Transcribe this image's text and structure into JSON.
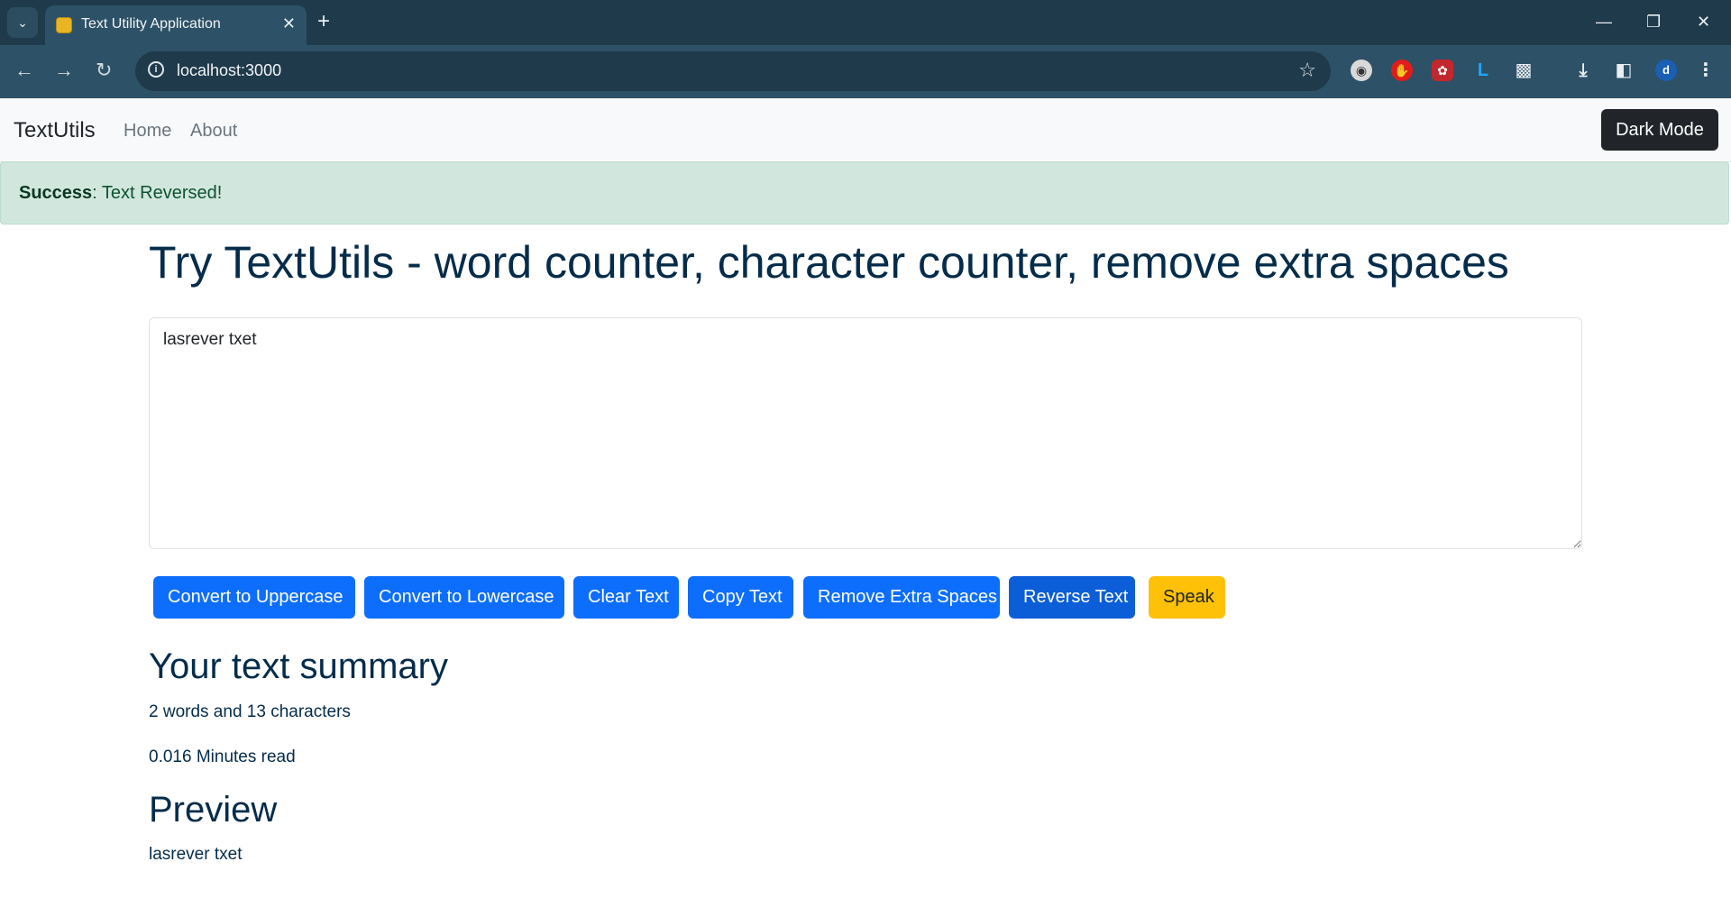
{
  "browser": {
    "tab_title": "Text Utility Application",
    "url": "localhost:3000"
  },
  "navbar": {
    "brand": "TextUtils",
    "links": [
      "Home",
      "About"
    ],
    "dark_mode_label": "Dark Mode"
  },
  "alert": {
    "type_label": "Success",
    "message": ": Text Reversed!"
  },
  "main": {
    "title": "Try TextUtils - word counter, character counter, remove extra spaces",
    "textarea_value": "lasrever txet",
    "buttons": [
      "Convert to Uppercase",
      "Convert to Lowercase",
      "Clear Text",
      "Copy Text",
      "Remove Extra Spaces",
      "Reverse Text",
      "Speak"
    ]
  },
  "summary": {
    "heading": "Your text summary",
    "counts": "2 words and 13 characters",
    "read_time": "0.016 Minutes read"
  },
  "preview": {
    "heading": "Preview",
    "text": "lasrever txet"
  },
  "colors": {
    "primary": "#0d6efd",
    "warning": "#ffc107",
    "success_bg": "#d1e7dd",
    "heading": "#052c4a"
  }
}
